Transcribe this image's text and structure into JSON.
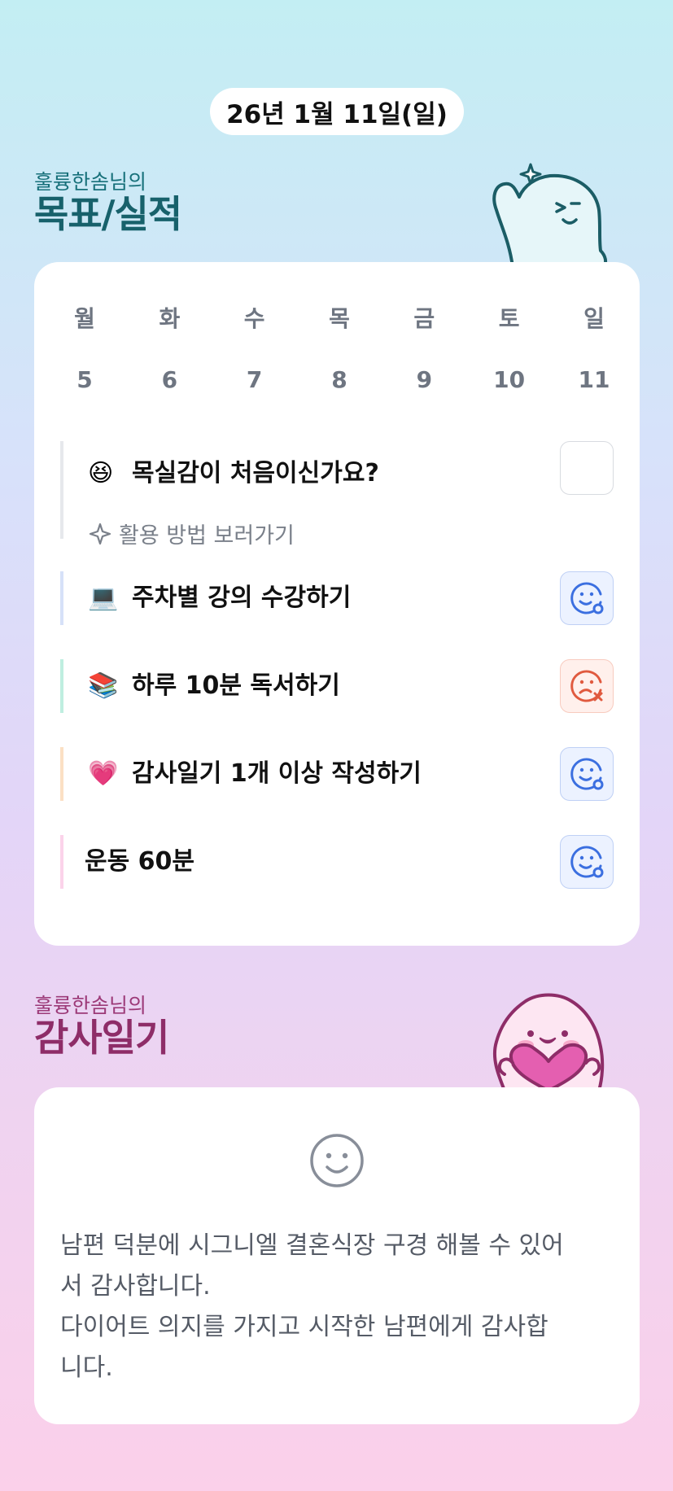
{
  "header": {
    "date": "26년 1월 11일(일)"
  },
  "goals_section": {
    "owner": "훌륭한솜님의",
    "title": "목표/실적"
  },
  "week": {
    "weekdays": [
      "월",
      "화",
      "수",
      "목",
      "금",
      "토",
      "일"
    ],
    "days": [
      "5",
      "6",
      "7",
      "8",
      "9",
      "10",
      "11"
    ]
  },
  "goals": [
    {
      "emoji": "😆",
      "label": "목실감이 처음이신가요?",
      "accent": "#e6e8ec",
      "status": "empty",
      "link_label": "활용 방법 보러가기",
      "link_icon": "sparkle-icon"
    },
    {
      "emoji": "💻",
      "label": "주차별 강의 수강하기",
      "accent": "#d6e1f8",
      "status": "done",
      "status_icon": "smile-check-icon",
      "status_color": "#3b6fe0"
    },
    {
      "emoji": "📚",
      "label": "하루 10분 독서하기",
      "accent": "#bfeee0",
      "status": "failed",
      "status_icon": "sad-x-icon",
      "status_color": "#e05a3f"
    },
    {
      "emoji": "💗",
      "label": "감사일기 1개 이상 작성하기",
      "accent": "#fbe0c4",
      "status": "done",
      "status_icon": "smile-check-icon",
      "status_color": "#3b6fe0"
    },
    {
      "emoji": "",
      "label": "운동 60분",
      "accent": "#fbd3ea",
      "status": "done",
      "status_icon": "smile-check-icon",
      "status_color": "#3b6fe0"
    }
  ],
  "thanks_section": {
    "owner": "훌륭한솜님의",
    "title": "감사일기",
    "mood_icon": "smile-face-icon",
    "text": "남편 덕분에 시그니엘 결혼식장 구경 해볼 수 있어\n서 감사합니다.\n다이어트 의지를 가지고 시작한 남편에게 감사합\n니다."
  }
}
